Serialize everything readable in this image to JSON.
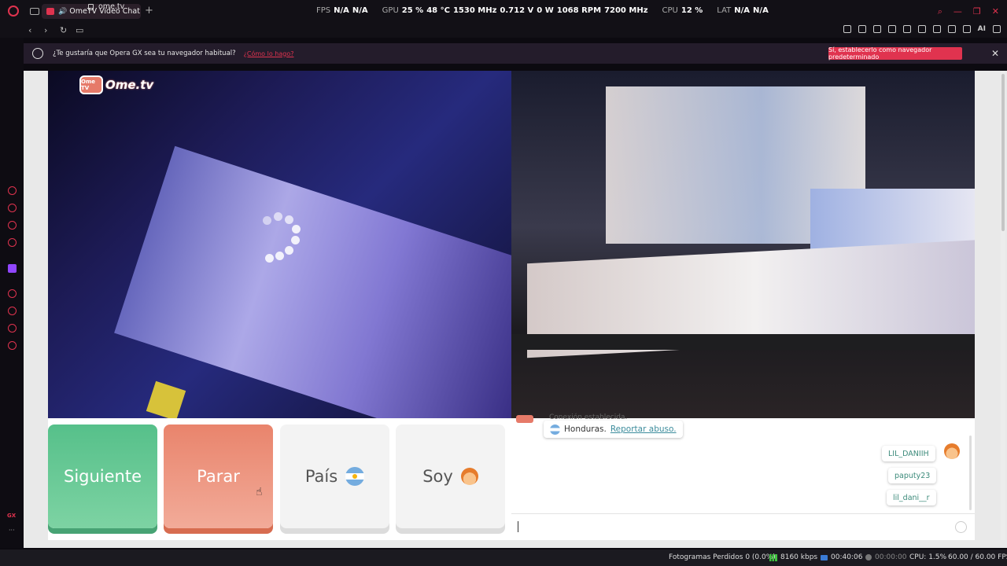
{
  "browser": {
    "tab_title": "OmeTV Video Chat — ...",
    "new_tab_glyph": "+",
    "url": "ome.tv",
    "hud": {
      "fps_label": "FPS",
      "fps_value1": "N/A",
      "fps_value2": "N/A",
      "gpu_label": "GPU",
      "gpu_load": "25 %",
      "gpu_temp": "48 °C",
      "gpu_clock": "1530 MHz",
      "gpu_volt": "0.712 V",
      "gpu_power": "0 W",
      "gpu_fan": "1068 RPM",
      "gpu_mem": "7200 MHz",
      "cpu_label": "CPU",
      "cpu_value": "12 %",
      "lat_label": "LAT",
      "lat_value1": "N/A",
      "lat_value2": "N/A"
    },
    "nav": {
      "back": "‹",
      "forward": "›",
      "reload": "↻"
    },
    "ai_label": "AI"
  },
  "notification": {
    "question": "¿Te gustaría que Opera GX sea tu navegador habitual?",
    "how_link": "¿Cómo lo hago?",
    "set_default_button": "Sí, establecerlo como navegador predeterminado",
    "close": "✕"
  },
  "ometv": {
    "logo_badge": "Ome TV",
    "logo_text": "Ome.tv",
    "buttons": {
      "next": "Siguiente",
      "stop": "Parar",
      "country": "País",
      "iam": "Soy"
    },
    "chat": {
      "system_top": "Conexión establecida.",
      "country_text": "Honduras.",
      "report_link": "Reportar abuso.",
      "messages": [
        "LIL_DANIIH",
        "paputy23",
        "lil_dani__r"
      ]
    }
  },
  "statusbar": {
    "dropped": "Fotogramas Perdidos 0 (0.0%)",
    "bitrate": "8160 kbps",
    "time_stream": "00:40:06",
    "time_rec": "00:00:00",
    "cpu": "CPU: 1.5%",
    "fps": "60.00 / 60.00 FPS"
  },
  "sidebar": {
    "gx_label": "GX",
    "more": "···"
  },
  "colors": {
    "accent": "#e0334f",
    "next_green": "#56c08a",
    "stop_orange": "#e9846c",
    "twitch": "#9146ff"
  }
}
